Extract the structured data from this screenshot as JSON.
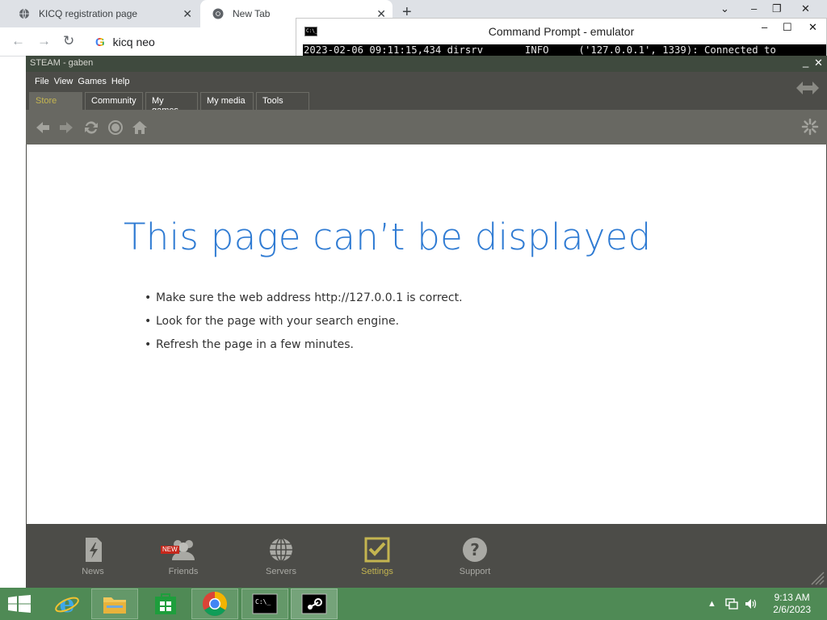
{
  "chrome": {
    "tabs": [
      {
        "label": "KICQ registration page",
        "icon": "globe-icon"
      },
      {
        "label": "New Tab",
        "icon": "chrome-icon"
      }
    ],
    "new_tab_symbol": "+",
    "address_value": "kicq neo"
  },
  "cmd": {
    "title": "Command Prompt - emulator",
    "log_line": "2023-02-06 09:11:15,434 dirsrv       INFO     ('127.0.0.1', 1339): Connected to"
  },
  "steam": {
    "title": "STEAM - gaben",
    "menu": [
      "File",
      "View",
      "Games",
      "Help"
    ],
    "tabs": [
      "Store",
      "Community",
      "My games",
      "My media",
      "Tools"
    ],
    "active_tab": "Store",
    "accent_color": "#c4b550",
    "error": {
      "title": "This page can’t be displayed",
      "items": [
        "Make sure the web address http://127.0.0.1 is correct.",
        "Look for the page with your search engine.",
        "Refresh the page in a few minutes."
      ]
    },
    "bottom_nav": [
      {
        "label": "News",
        "icon": "news-icon"
      },
      {
        "label": "Friends",
        "icon": "friends-icon",
        "badge": "NEW"
      },
      {
        "label": "Servers",
        "icon": "globe-icon"
      },
      {
        "label": "Settings",
        "icon": "checkbox-icon",
        "active": true
      },
      {
        "label": "Support",
        "icon": "help-icon"
      }
    ]
  },
  "taskbar": {
    "time": "9:13 AM",
    "date": "2/6/2023",
    "apps": [
      "internet-explorer",
      "file-explorer",
      "store",
      "chrome",
      "command-prompt",
      "steam"
    ]
  }
}
